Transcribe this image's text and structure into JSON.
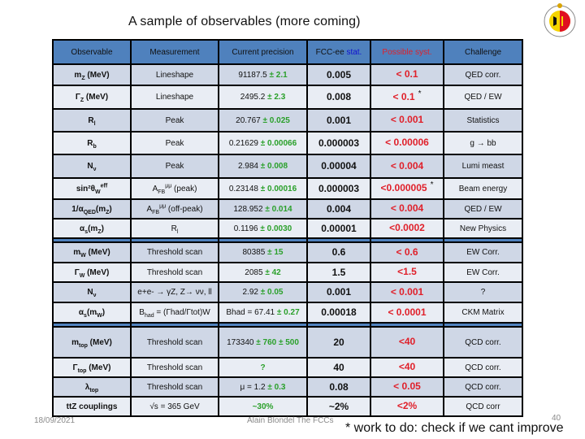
{
  "title": "A sample of observables (more coming)",
  "logo_icon": "university-of-geneva-seal",
  "table": {
    "headers": {
      "observable": "Observable",
      "measurement": "Measurement",
      "current_precision": "Current precision",
      "fcc_prefix": "FCC-ee ",
      "fcc_suffix": "stat.",
      "possible_syst": "Possible syst.",
      "challenge": "Challenge"
    },
    "sections": [
      {
        "rows": [
          {
            "obs": "m",
            "obs_sub": "Z",
            "obs_rest": " (MeV)",
            "meas": "Lineshape",
            "cur": "91187.5 ",
            "cur_err": "± 2.1",
            "stat": "0.005",
            "syst": "< 0.1",
            "star": "",
            "challenge": "QED corr."
          },
          {
            "obs": "Γ",
            "obs_sub": "Z",
            "obs_rest": " (MeV)",
            "meas": "Lineshape",
            "cur": "2495.2 ",
            "cur_err": "± 2.3",
            "stat": "0.008",
            "syst": "< 0.1",
            "star": "*",
            "challenge": "QED / EW"
          },
          {
            "obs": "R",
            "obs_sub": "l",
            "obs_rest": "",
            "meas": "Peak",
            "cur": "20.767 ",
            "cur_err": "± 0.025",
            "stat": "0.001",
            "syst": "< 0.001",
            "star": "",
            "challenge": "Statistics"
          },
          {
            "obs": "R",
            "obs_sub": "b",
            "obs_rest": "",
            "meas": "Peak",
            "cur": "0.21629 ",
            "cur_err": "± 0.00066",
            "stat": "0.000003",
            "syst": "< 0.00006",
            "star": "",
            "challenge": "g → bb"
          },
          {
            "obs": "N",
            "obs_sub": "ν",
            "obs_rest": "",
            "meas": "Peak",
            "cur": "2.984 ",
            "cur_err": "± 0.008",
            "stat": "0.00004",
            "syst": "< 0.004",
            "star": "",
            "challenge": "Lumi meast"
          },
          {
            "obs": "sin²θ",
            "obs_sub": "W",
            "obs_sup": "eff",
            "obs_rest": "",
            "meas": "A",
            "meas_sub": "FB",
            "meas_sup": "μμ",
            "meas_rest": " (peak)",
            "cur": "0.23148 ",
            "cur_err": "± 0.00016",
            "stat": "0.000003",
            "syst": "<0.000005",
            "star": "*",
            "challenge": "Beam energy"
          },
          {
            "obs": "1/α",
            "obs_sub": "QED",
            "obs_rest": "(m",
            "obs_sub2": "Z",
            "obs_rest2": ")",
            "meas": "A",
            "meas_sub": "FB",
            "meas_sup": "μμ",
            "meas_rest": " (off-peak)",
            "cur": "128.952 ",
            "cur_err": "± 0.014",
            "stat": "0.004",
            "syst": "< 0.004",
            "star": "",
            "challenge": "QED / EW"
          },
          {
            "obs": "α",
            "obs_sub": "s",
            "obs_rest": "(m",
            "obs_sub2": "Z",
            "obs_rest2": ")",
            "meas": "R",
            "meas_sub": "l",
            "cur": "0.1196 ",
            "cur_err": "± 0.0030",
            "stat": "0.00001",
            "syst": "<0.0002",
            "star": "",
            "challenge": "New Physics"
          }
        ]
      },
      {
        "rows": [
          {
            "obs": "m",
            "obs_sub": "W",
            "obs_rest": " (MeV)",
            "meas": "Threshold scan",
            "cur": "80385 ",
            "cur_err": "± 15",
            "stat": "0.6",
            "syst": "< 0.6",
            "star": "",
            "challenge": "EW Corr."
          },
          {
            "obs": "Γ",
            "obs_sub": "W",
            "obs_rest": " (MeV)",
            "meas": "Threshold scan",
            "cur": "2085 ",
            "cur_err": "± 42",
            "stat": "1.5",
            "syst": "<1.5",
            "star": "",
            "challenge": "EW Corr."
          },
          {
            "obs": "N",
            "obs_sub": "ν",
            "obs_rest": "",
            "meas": "e+e- → γZ, Z→ νν, ll",
            "cur": "2.92 ",
            "cur_err": "± 0.05",
            "stat": "0.001",
            "syst": "< 0.001",
            "star": "",
            "challenge": "?"
          },
          {
            "obs": "α",
            "obs_sub": "s",
            "obs_rest": "(m",
            "obs_sub2": "W",
            "obs_rest2": ")",
            "meas": "B",
            "meas_sub": "had",
            "meas_rest": " = (Γhad/Γtot)W",
            "cur": "Bhad = 67.41 ",
            "cur_err": "± 0.27",
            "stat": "0.00018",
            "syst": "< 0.0001",
            "star": "",
            "challenge": "CKM Matrix"
          }
        ]
      },
      {
        "rows": [
          {
            "obs": "m",
            "obs_sub": "top",
            "obs_rest": " (MeV)",
            "meas": "Threshold scan",
            "cur": "173340 ",
            "cur_err": "± 760 ± 500",
            "stat": "20",
            "syst": "<40",
            "star": "",
            "challenge": "QCD corr."
          },
          {
            "obs": "Γ",
            "obs_sub": "top",
            "obs_rest": " (MeV)",
            "meas": "Threshold scan",
            "cur": "",
            "cur_err": "?",
            "stat": "40",
            "syst": "<40",
            "star": "",
            "challenge": "QCD corr."
          },
          {
            "obs": "λ",
            "obs_sub": "top",
            "obs_rest": "",
            "meas": "Threshold scan",
            "cur": "μ = 1.2 ",
            "cur_err": "± 0.3",
            "stat": "0.08",
            "syst": "< 0.05",
            "star": "",
            "challenge": "QCD corr."
          },
          {
            "obs": "ttZ couplings",
            "obs_sub": "",
            "obs_rest": "",
            "meas": "√s = 365 GeV",
            "cur": "",
            "cur_err": "~30%",
            "stat": "~2%",
            "syst": "<2%",
            "star": "",
            "challenge": "QCD corr"
          }
        ]
      }
    ]
  },
  "footer": {
    "date": "18/09/2021",
    "author": "Alain Blondel The FCCs",
    "page": "40",
    "footnote": "*  work to do: check if we cant improve"
  },
  "colors": {
    "header_bg": "#4f81bd",
    "row_odd": "#cfd7e6",
    "row_even": "#e9edf4",
    "current_err": "#2aa02a",
    "stat": "#1a237e",
    "syst": "#e0202a"
  }
}
